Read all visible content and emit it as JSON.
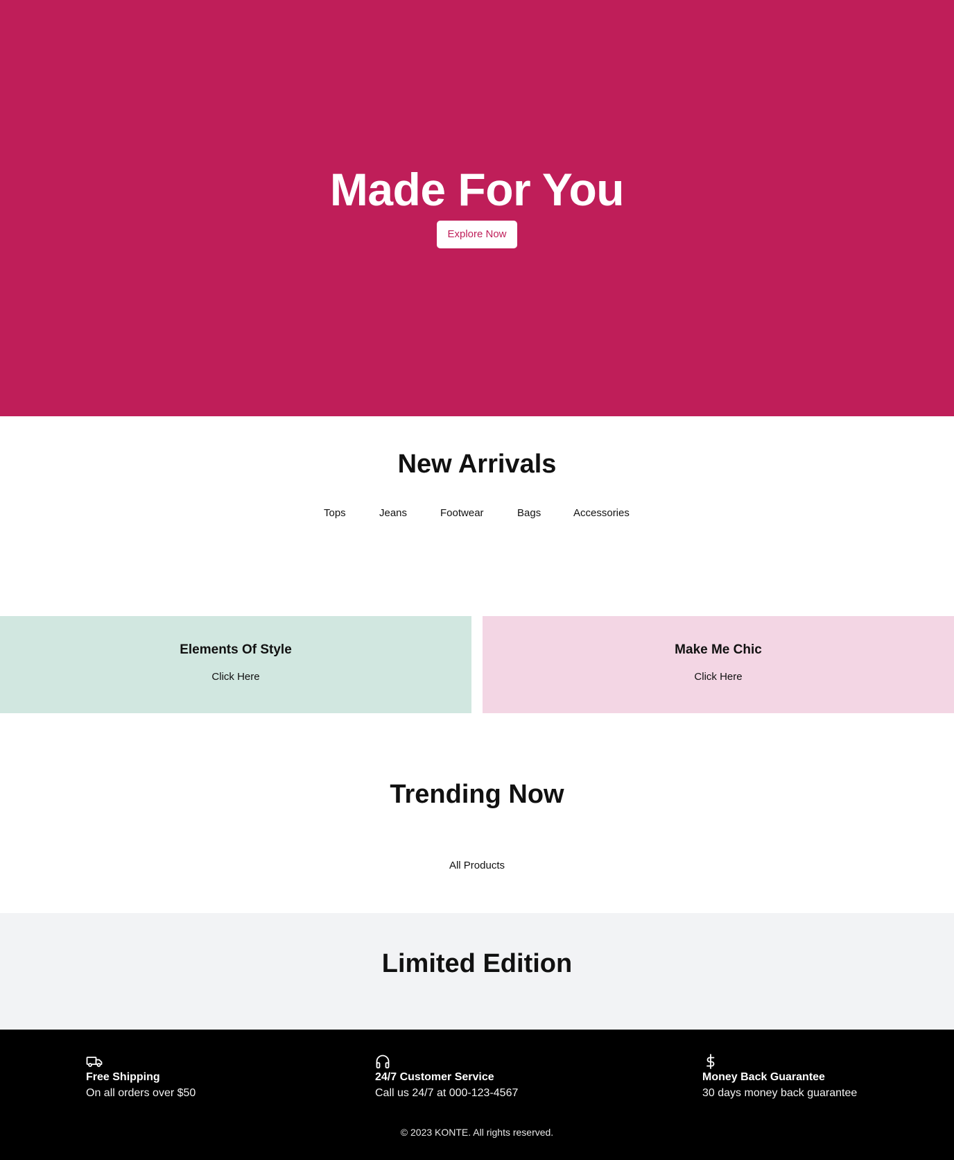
{
  "hero": {
    "title": "Made For You",
    "button_label": "Explore Now",
    "background_color": "#bf1e59"
  },
  "new_arrivals": {
    "title": "New Arrivals",
    "tabs": [
      "Tops",
      "Jeans",
      "Footwear",
      "Bags",
      "Accessories"
    ]
  },
  "promos": [
    {
      "title": "Elements Of Style",
      "link_label": "Click Here",
      "background_color": "#d1e7e0"
    },
    {
      "title": "Make Me Chic",
      "link_label": "Click Here",
      "background_color": "#f3d6e4"
    }
  ],
  "trending": {
    "title": "Trending Now",
    "link_label": "All Products"
  },
  "limited_edition": {
    "title": "Limited Edition"
  },
  "footer": {
    "features": [
      {
        "icon": "truck-icon",
        "title": "Free Shipping",
        "description": "On all orders over $50"
      },
      {
        "icon": "headphones-icon",
        "title": "24/7 Customer Service",
        "description": "Call us 24/7 at 000-123-4567"
      },
      {
        "icon": "dollar-icon",
        "title": "Money Back Guarantee",
        "description": "30 days money back guarantee"
      }
    ],
    "copyright": "© 2023 KONTE. All rights reserved."
  }
}
